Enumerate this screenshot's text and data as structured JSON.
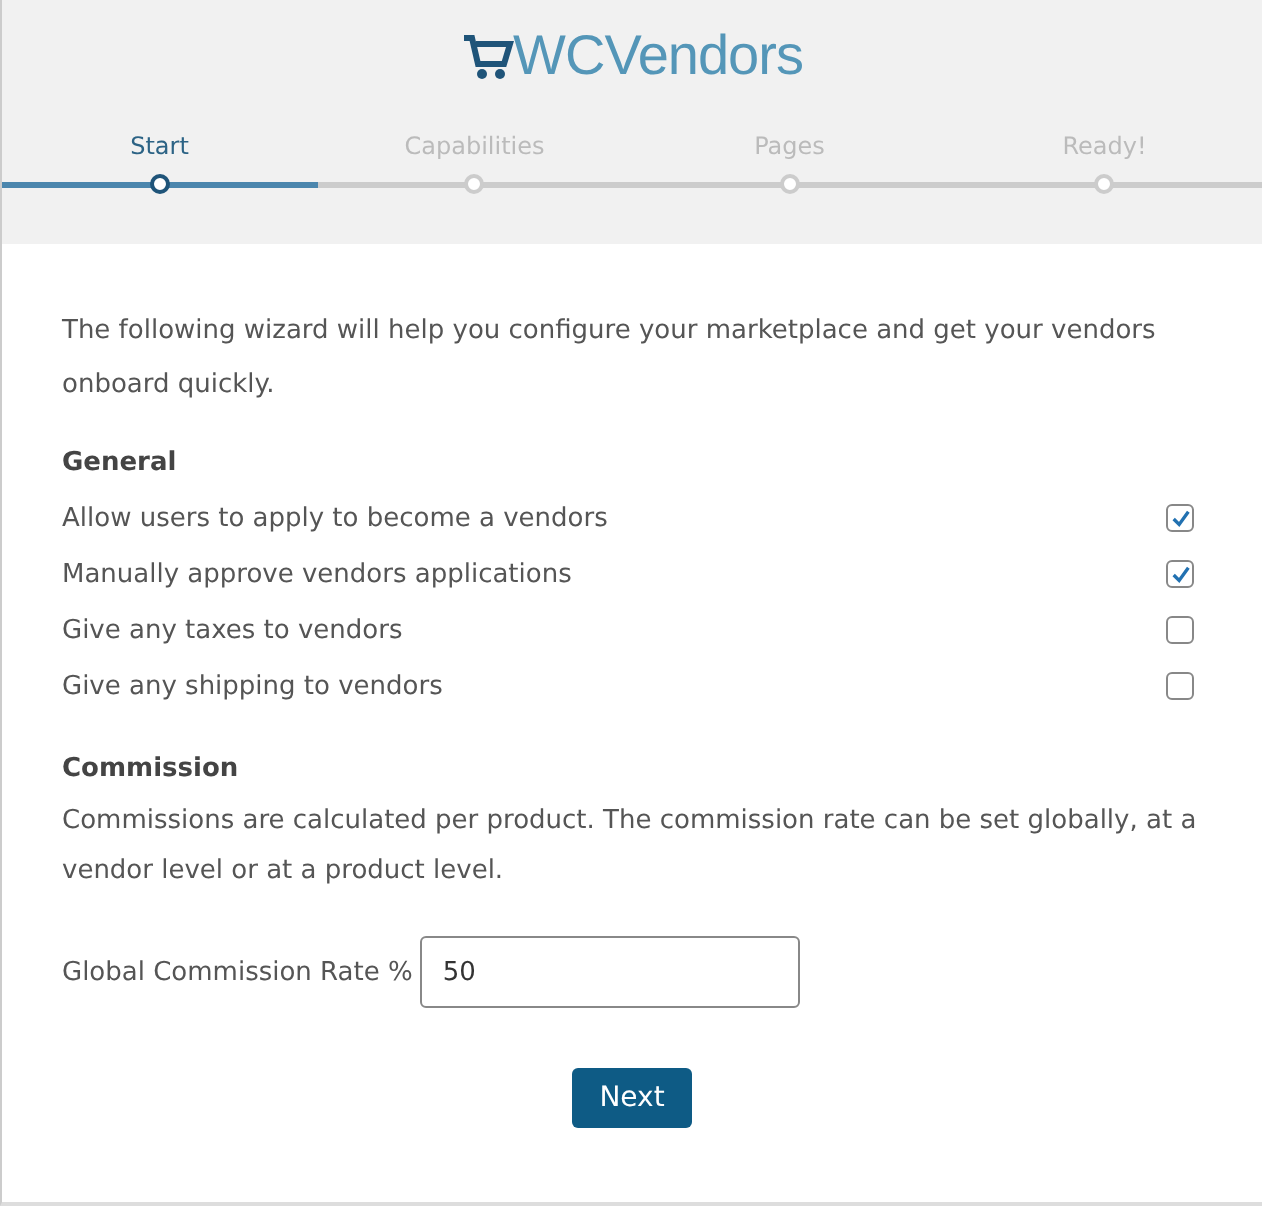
{
  "logo": {
    "text": "WCVendors"
  },
  "steps": [
    {
      "label": "Start",
      "selected": true
    },
    {
      "label": "Capabilities",
      "selected": false
    },
    {
      "label": "Pages",
      "selected": false
    },
    {
      "label": "Ready!",
      "selected": false
    }
  ],
  "intro": "The following wizard will help you configure your marketplace and get your vendors onboard quickly.",
  "general": {
    "heading": "General",
    "options": [
      {
        "label": "Allow users to apply to become a vendors",
        "checked": true
      },
      {
        "label": "Manually approve vendors applications",
        "checked": true
      },
      {
        "label": "Give any taxes to vendors",
        "checked": false
      },
      {
        "label": "Give any shipping to vendors",
        "checked": false
      }
    ]
  },
  "commission": {
    "heading": "Commission",
    "description": "Commissions are calculated per product. The commission rate can be set globally, at a vendor level or at a product level.",
    "rate_label": "Global Commission Rate %",
    "rate_value": "50"
  },
  "buttons": [
    "Next"
  ]
}
